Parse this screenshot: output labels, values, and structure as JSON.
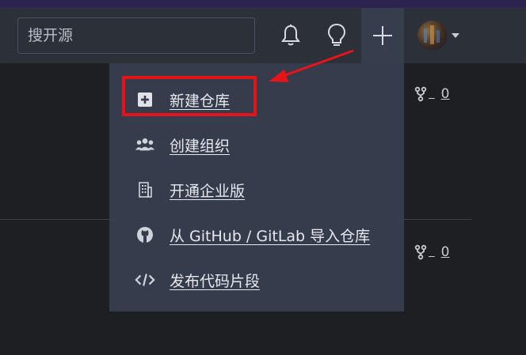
{
  "colors": {
    "accent_red": "#e6141a",
    "menu_bg": "#353c4b",
    "nav_bg": "#2b3039",
    "page_bg": "#1e1f23"
  },
  "navbar": {
    "search": {
      "placeholder": "搜开源"
    },
    "icons": [
      "bell-icon",
      "lightbulb-icon",
      "plus-icon",
      "avatar",
      "caret-down-icon"
    ]
  },
  "dropdown": {
    "items": [
      {
        "label": "新建仓库",
        "icon": "plus-square-icon"
      },
      {
        "label": "创建组织",
        "icon": "group-icon"
      },
      {
        "label": "开通企业版",
        "icon": "building-icon"
      },
      {
        "label": "从 GitHub / GitLab 导入仓库",
        "icon": "github-icon"
      },
      {
        "label": "发布代码片段",
        "icon": "code-icon"
      }
    ]
  },
  "repos": [
    {
      "fork_count": "0"
    },
    {
      "fork_count": "0"
    }
  ]
}
